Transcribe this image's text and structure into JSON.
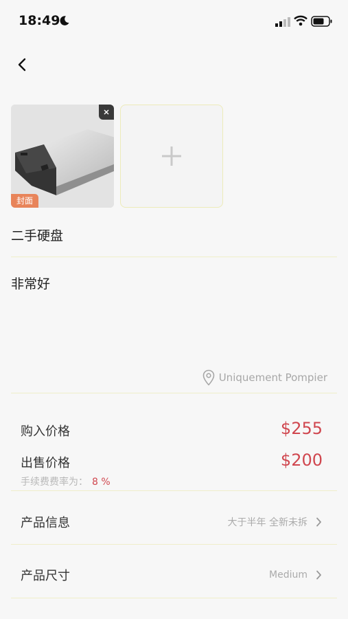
{
  "status_bar": {
    "time": "18:49"
  },
  "photos": {
    "cover_label": "封面"
  },
  "item": {
    "title": "二手硬盘",
    "description": "非常好",
    "location": "Uniquement Pompier"
  },
  "pricing": {
    "purchase_label": "购入价格",
    "purchase_value": "$255",
    "sale_label": "出售价格",
    "sale_value": "$200",
    "fee_label": "手续费费率为：",
    "fee_value": "8 %"
  },
  "product_info": {
    "label": "产品信息",
    "value": "大于半年 全新未拆"
  },
  "product_size": {
    "label": "产品尺寸",
    "value": "Medium"
  },
  "colors": {
    "accent_red": "#d0474f",
    "badge_orange": "#e8845a"
  },
  "icons": [
    "moon-icon",
    "signal-icon",
    "wifi-icon",
    "battery-icon",
    "back-arrow-icon",
    "close-icon",
    "plus-icon",
    "location-pin-icon",
    "chevron-right-icon"
  ]
}
